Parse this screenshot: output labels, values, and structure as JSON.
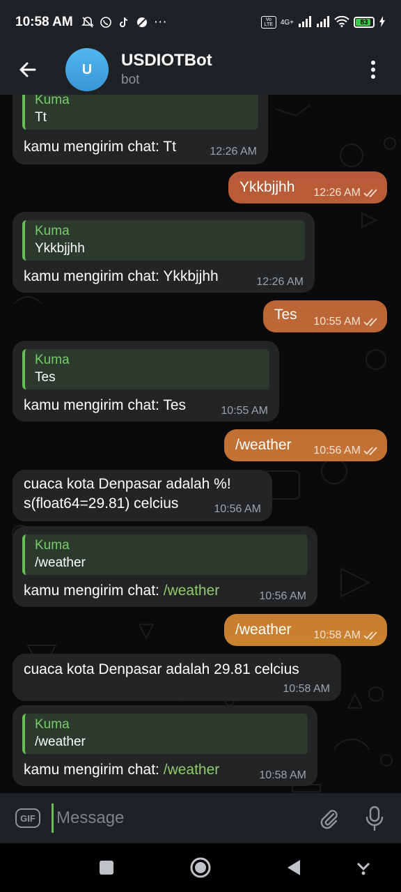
{
  "status_bar": {
    "time": "10:58 AM",
    "more": "···",
    "network_label": "4G+",
    "volte_label": "Vo LTE",
    "battery": "83"
  },
  "header": {
    "avatar_letter": "U",
    "title": "USDIOTBot",
    "subtitle": "bot"
  },
  "messages": [
    {
      "reply_name": "Kuma",
      "reply_text": "Tt",
      "prefix": "kamu mengirim chat: ",
      "text": "Tt",
      "time": "12:26 AM"
    },
    {
      "text": "Ykkbjjhh",
      "time": "12:26 AM"
    },
    {
      "reply_name": "Kuma",
      "reply_text": "Ykkbjjhh",
      "prefix": "kamu mengirim chat: ",
      "text": "Ykkbjjhh",
      "time": "12:26 AM"
    },
    {
      "text": "Tes",
      "time": "10:55 AM"
    },
    {
      "reply_name": "Kuma",
      "reply_text": "Tes",
      "prefix": "kamu mengirim chat: ",
      "text": "Tes",
      "time": "10:55 AM"
    },
    {
      "text": "/weather",
      "time": "10:56 AM"
    },
    {
      "line1": "cuaca kota Denpasar adalah %!",
      "line2": "s(float64=29.81) celcius",
      "time": "10:56 AM"
    },
    {
      "reply_name": "Kuma",
      "reply_text": "/weather",
      "prefix": "kamu mengirim chat: ",
      "text": "/weather",
      "time": "10:56 AM"
    },
    {
      "text": "/weather",
      "time": "10:58 AM"
    },
    {
      "text": "cuaca kota Denpasar adalah 29.81 celcius",
      "time": "10:58 AM"
    },
    {
      "reply_name": "Kuma",
      "reply_text": "/weather",
      "prefix": "kamu mengirim chat: ",
      "text": "/weather",
      "time": "10:58 AM"
    }
  ],
  "input": {
    "gif_label": "GIF",
    "placeholder": "Message"
  },
  "colors": {
    "outgoing_bubble_top": "#b4543a",
    "outgoing_bubble_bottom": "#cf8e2d",
    "incoming_bubble": "#222426",
    "reply_accent": "#67c056",
    "header_bg": "#1f2225"
  }
}
